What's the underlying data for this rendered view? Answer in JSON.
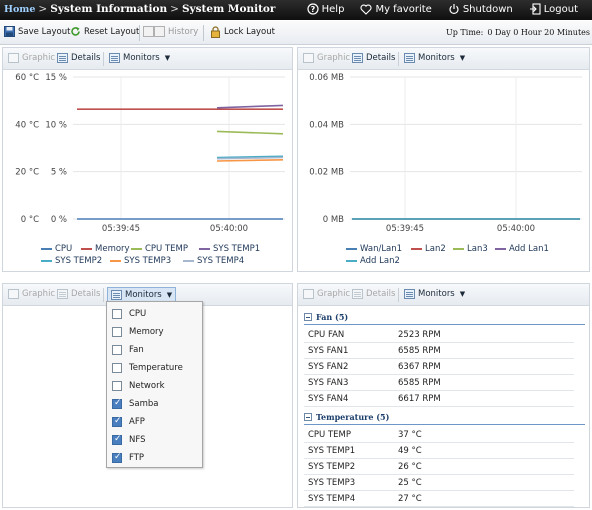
{
  "header": {
    "breadcrumb": [
      "Home",
      "System Information",
      "System Monitor"
    ],
    "separator": ">",
    "actions": [
      {
        "label": "Help",
        "icon": "help-icon"
      },
      {
        "label": "My favorite",
        "icon": "heart-icon"
      },
      {
        "label": "Shutdown",
        "icon": "power-icon"
      },
      {
        "label": "Logout",
        "icon": "logout-icon"
      }
    ]
  },
  "toolbar": {
    "save_layout": "Save Layout",
    "reset_layout": "Reset Layout",
    "history": "History",
    "lock_layout": "Lock Layout",
    "uptime_label": "Up Time:",
    "uptime_value": "0 Day 0 Hour 20 Minutes"
  },
  "panel_toolbar": {
    "graphic": "Graphic",
    "details": "Details",
    "monitors": "Monitors"
  },
  "panels": {
    "top_left": {
      "chart_data": {
        "type": "line",
        "x_ticks": [
          "05:39:45",
          "05:40:00"
        ],
        "y_left_ticks": [
          "0 °C",
          "20 °C",
          "40 °C",
          "60 °C"
        ],
        "y_right_ticks": [
          "0 %",
          "5 %",
          "10 %",
          "15 %"
        ],
        "y_left_range": [
          0,
          60
        ],
        "y_right_range": [
          0,
          15
        ],
        "series": [
          {
            "name": "CPU",
            "color": "#4a7fb5",
            "values": [
              0,
              0,
              0,
              0
            ],
            "axis": "right"
          },
          {
            "name": "Memory",
            "color": "#c0504d",
            "values": [
              11.6,
              11.6,
              11.6,
              11.6
            ],
            "axis": "right"
          },
          {
            "name": "CPU TEMP",
            "color": "#9bbb59",
            "values": [
              null,
              null,
              37,
              36
            ],
            "axis": "left"
          },
          {
            "name": "SYS TEMP1",
            "color": "#8064a2",
            "values": [
              null,
              null,
              47,
              48
            ],
            "axis": "left"
          },
          {
            "name": "SYS TEMP2",
            "color": "#4bacc6",
            "values": [
              null,
              null,
              26,
              26.5
            ],
            "axis": "left"
          },
          {
            "name": "SYS TEMP3",
            "color": "#f79646",
            "values": [
              null,
              null,
              24.5,
              25
            ],
            "axis": "left"
          },
          {
            "name": "SYS TEMP4",
            "color": "#a6b8d0",
            "values": [
              null,
              null,
              25.5,
              26
            ],
            "axis": "left"
          }
        ],
        "grid": true,
        "legend": "bottom"
      }
    },
    "top_right": {
      "chart_data": {
        "type": "line",
        "x_ticks": [
          "05:39:45",
          "05:40:00"
        ],
        "y_ticks": [
          "0 MB",
          "0.02 MB",
          "0.04 MB",
          "0.06 MB"
        ],
        "y_range": [
          0,
          0.06
        ],
        "series": [
          {
            "name": "Wan/Lan1",
            "color": "#4a7fb5",
            "values": [
              0,
              0
            ]
          },
          {
            "name": "Lan2",
            "color": "#c0504d",
            "values": [
              0,
              0
            ]
          },
          {
            "name": "Lan3",
            "color": "#9bbb59",
            "values": [
              0,
              0
            ]
          },
          {
            "name": "Add Lan1",
            "color": "#8064a2",
            "values": [
              0,
              0
            ]
          },
          {
            "name": "Add Lan2",
            "color": "#4bacc6",
            "values": [
              0,
              0
            ]
          }
        ],
        "grid": true,
        "legend": "bottom"
      }
    },
    "bottom_left": {
      "monitors_menu": [
        {
          "label": "CPU",
          "checked": false
        },
        {
          "label": "Memory",
          "checked": false
        },
        {
          "label": "Fan",
          "checked": false
        },
        {
          "label": "Temperature",
          "checked": false
        },
        {
          "label": "Network",
          "checked": false
        },
        {
          "label": "Samba",
          "checked": true
        },
        {
          "label": "AFP",
          "checked": true
        },
        {
          "label": "NFS",
          "checked": true
        },
        {
          "label": "FTP",
          "checked": true
        }
      ]
    },
    "bottom_right": {
      "sections": [
        {
          "title": "Fan (5)",
          "rows": [
            {
              "name": "CPU FAN",
              "value": "2523 RPM"
            },
            {
              "name": "SYS FAN1",
              "value": "6585 RPM"
            },
            {
              "name": "SYS FAN2",
              "value": "6367 RPM"
            },
            {
              "name": "SYS FAN3",
              "value": "6585 RPM"
            },
            {
              "name": "SYS FAN4",
              "value": "6617 RPM"
            }
          ]
        },
        {
          "title": "Temperature (5)",
          "rows": [
            {
              "name": "CPU TEMP",
              "value": "37 °C"
            },
            {
              "name": "SYS TEMP1",
              "value": "49 °C"
            },
            {
              "name": "SYS TEMP2",
              "value": "26 °C"
            },
            {
              "name": "SYS TEMP3",
              "value": "25 °C"
            },
            {
              "name": "SYS TEMP4",
              "value": "27 °C"
            }
          ]
        }
      ]
    }
  }
}
